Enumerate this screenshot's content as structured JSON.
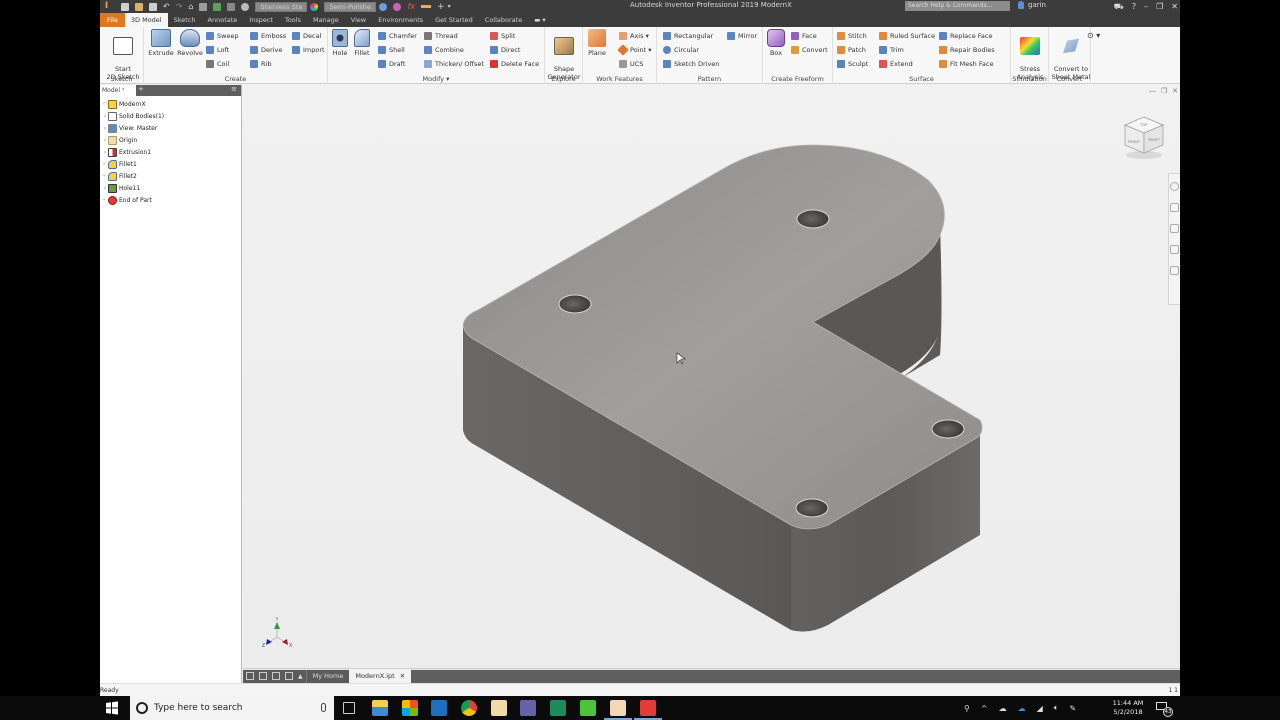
{
  "app": {
    "window_title": "Autodesk Inventor Professional 2019    ModernX",
    "material": "Stainless Steel",
    "appearance": "Semi-Polished",
    "search_placeholder": "Search Help & Commands...",
    "user": "garin",
    "accent_color": "#e0771f"
  },
  "ribbon_tabs": [
    {
      "label": "File"
    },
    {
      "label": "3D Model"
    },
    {
      "label": "Sketch"
    },
    {
      "label": "Annotate"
    },
    {
      "label": "Inspect"
    },
    {
      "label": "Tools"
    },
    {
      "label": "Manage"
    },
    {
      "label": "View"
    },
    {
      "label": "Environments"
    },
    {
      "label": "Get Started"
    },
    {
      "label": "Collaborate"
    }
  ],
  "ribbon": {
    "sketch": {
      "label": "Sketch",
      "start_sketch": "Start\n2D Sketch"
    },
    "create": {
      "label": "Create",
      "extrude": "Extrude",
      "revolve": "Revolve",
      "sweep": "Sweep",
      "loft": "Loft",
      "coil": "Coil",
      "emboss": "Emboss",
      "derive": "Derive",
      "rib": "Rib",
      "decal": "Decal",
      "import": "Import"
    },
    "modify": {
      "label": "Modify",
      "hole": "Hole",
      "fillet": "Fillet",
      "chamfer": "Chamfer",
      "shell": "Shell",
      "draft": "Draft",
      "thread": "Thread",
      "combine": "Combine",
      "thicken": "Thicken/ Offset",
      "split": "Split",
      "direct": "Direct",
      "delete_face": "Delete Face"
    },
    "explore": {
      "label": "Explore",
      "shape_generator": "Shape\nGenerator"
    },
    "work_features": {
      "label": "Work Features",
      "plane": "Plane",
      "axis": "Axis",
      "point": "Point",
      "ucs": "UCS"
    },
    "pattern": {
      "label": "Pattern",
      "rectangular": "Rectangular",
      "circular": "Circular",
      "sketch_driven": "Sketch Driven",
      "mirror": "Mirror"
    },
    "create_freeform": {
      "label": "Create Freeform",
      "box": "Box",
      "face": "Face",
      "convert": "Convert"
    },
    "surface": {
      "label": "Surface",
      "stitch": "Stitch",
      "patch": "Patch",
      "sculpt": "Sculpt",
      "ruled_surface": "Ruled Surface",
      "trim": "Trim",
      "extend": "Extend",
      "replace_face": "Replace Face",
      "repair_bodies": "Repair Bodies",
      "fit_mesh_face": "Fit Mesh Face"
    },
    "simulation": {
      "label": "Simulation",
      "stress_analysis": "Stress\nAnalysis"
    },
    "convert": {
      "label": "Convert",
      "convert_sheet_metal": "Convert to\nSheet Metal"
    }
  },
  "browser": {
    "tab_label": "Model",
    "items": [
      {
        "label": "ModernX",
        "icon": "part-icon"
      },
      {
        "label": "Solid Bodies(1)",
        "icon": "solid-bodies-icon"
      },
      {
        "label": "View: Master",
        "icon": "view-icon"
      },
      {
        "label": "Origin",
        "icon": "folder-icon"
      },
      {
        "label": "Extrusion1",
        "icon": "extrusion-icon"
      },
      {
        "label": "Fillet1",
        "icon": "fillet-icon"
      },
      {
        "label": "Fillet2",
        "icon": "fillet-icon"
      },
      {
        "label": "Hole11",
        "icon": "hole-icon"
      },
      {
        "label": "End of Part",
        "icon": "end-of-part-icon"
      }
    ]
  },
  "viewcube": {
    "top": "TOP",
    "front": "FRONT",
    "right": "RIGHT"
  },
  "triad": {
    "x": "X",
    "y": "Y",
    "z": "Z"
  },
  "doc_tabs": {
    "home": "My Home",
    "active": "ModernX.ipt"
  },
  "status": {
    "text": "Ready",
    "counts": "1  1"
  },
  "taskbar": {
    "search_placeholder": "Type here to search",
    "time": "11:44 AM",
    "date": "5/2/2018",
    "notification_count": "43"
  }
}
